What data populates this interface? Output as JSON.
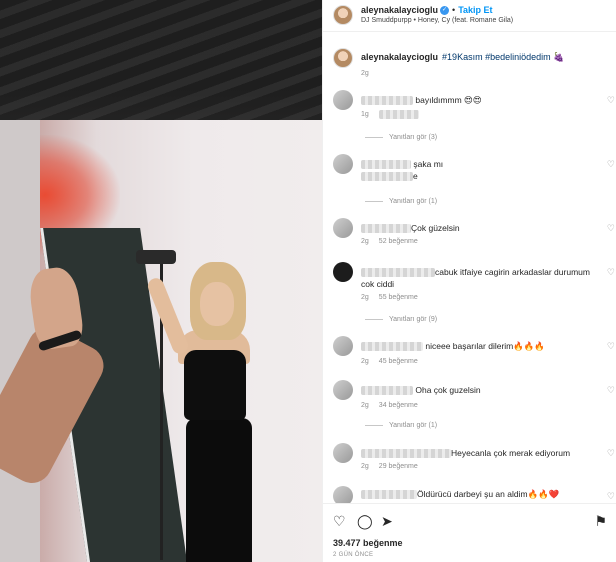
{
  "post": {
    "username": "aleynakalaycioglu",
    "follow_label": "Takip Et",
    "music": "DJ Smuddpurpp • Honey, Cy (feat. Romane Gila)",
    "caption_username": "aleynakalaycioglu",
    "caption_text": "#19Kasım #bedeliniödedim 🍇",
    "caption_time": "2g"
  },
  "comments": [
    {
      "text": "bayıldımmm 😍😍",
      "meta_time": "1g",
      "likes": "",
      "replies": "Yanıtları gör (3)"
    },
    {
      "text": "şaka mı",
      "meta_time": "",
      "likes": "",
      "replies": "Yanıtları gör (1)"
    },
    {
      "text": "Çok güzelsin",
      "meta_time": "2g",
      "likes": "52 beğenme",
      "replies": ""
    },
    {
      "text": "cabuk itfaiye cagirin arkadaslar durumum cok ciddi",
      "meta_time": "2g",
      "likes": "55 beğenme",
      "replies": "Yanıtları gör (9)"
    },
    {
      "text": "niceee başarılar dilerim🔥🔥🔥",
      "meta_time": "2g",
      "likes": "45 beğenme",
      "replies": ""
    },
    {
      "text": "Oha çok guzelsin",
      "meta_time": "2g",
      "likes": "34 beğenme",
      "replies": "Yanıtları gör (1)"
    },
    {
      "text": "Heyecanla çok merak ediyorum",
      "meta_time": "2g",
      "likes": "29 beğenme",
      "replies": ""
    },
    {
      "text": "Öldürücü darbeyi şu an aldim🔥🔥❤️",
      "meta_time": "",
      "likes": "",
      "replies": ""
    }
  ],
  "footer": {
    "likes": "39.477 beğenme",
    "time_ago": "2 GÜN ÖNCE"
  },
  "icons": {
    "heart": "heart-icon",
    "comment": "comment-icon",
    "share": "share-icon",
    "save": "bookmark-icon"
  },
  "colors": {
    "link": "#0095f6",
    "verified": "#3897f0",
    "meta": "#8e8e8e"
  }
}
